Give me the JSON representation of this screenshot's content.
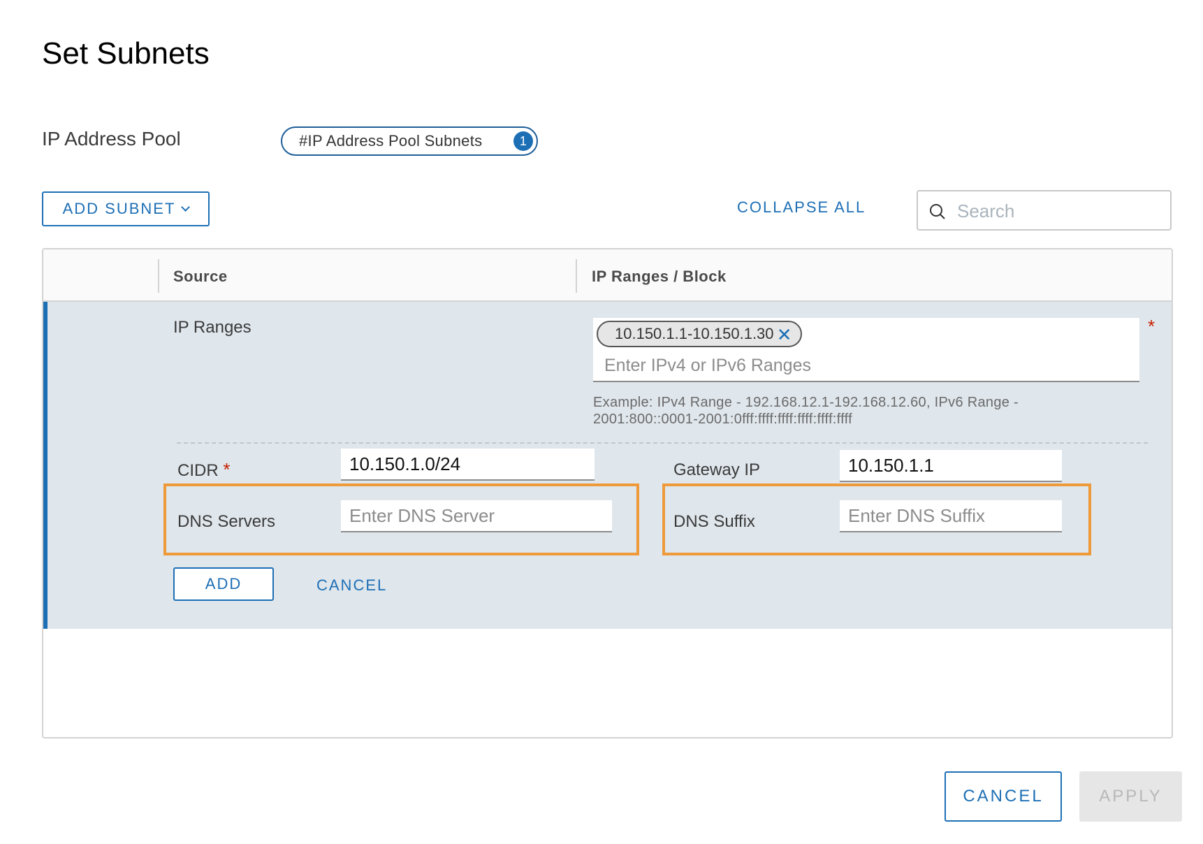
{
  "dialog": {
    "title": "Set Subnets"
  },
  "pool": {
    "label": "IP Address Pool",
    "pill_label": "#IP Address Pool Subnets",
    "pill_count": "1"
  },
  "toolbar": {
    "add_subnet_label": "ADD SUBNET",
    "collapse_all_label": "COLLAPSE ALL",
    "search_placeholder": "Search"
  },
  "grid": {
    "columns": [
      "Source",
      "IP Ranges / Block"
    ],
    "row": {
      "ip_ranges_label": "IP Ranges",
      "ip_range_chip": "10.150.1.1-10.150.1.30",
      "ip_ranges_placeholder": "Enter IPv4 or IPv6 Ranges",
      "ip_ranges_required": "*",
      "example_text": "Example: IPv4 Range - 192.168.12.1-192.168.12.60, IPv6 Range - 2001:800::0001-2001:0fff:ffff:ffff:ffff:ffff:ffff",
      "cidr_label": "CIDR",
      "cidr_required": "*",
      "cidr_value": "10.150.1.0/24",
      "gateway_label": "Gateway IP",
      "gateway_value": "10.150.1.1",
      "dns_servers_label": "DNS Servers",
      "dns_servers_placeholder": "Enter DNS Server",
      "dns_suffix_label": "DNS Suffix",
      "dns_suffix_placeholder": "Enter DNS Suffix",
      "add_label": "ADD",
      "cancel_label": "CANCEL"
    }
  },
  "footer": {
    "cancel_label": "CANCEL",
    "apply_label": "APPLY"
  },
  "colors": {
    "accent": "#1d6fb5",
    "highlight": "#ee9a3a",
    "required": "#c92100",
    "row_bg": "#dfe6ec"
  }
}
